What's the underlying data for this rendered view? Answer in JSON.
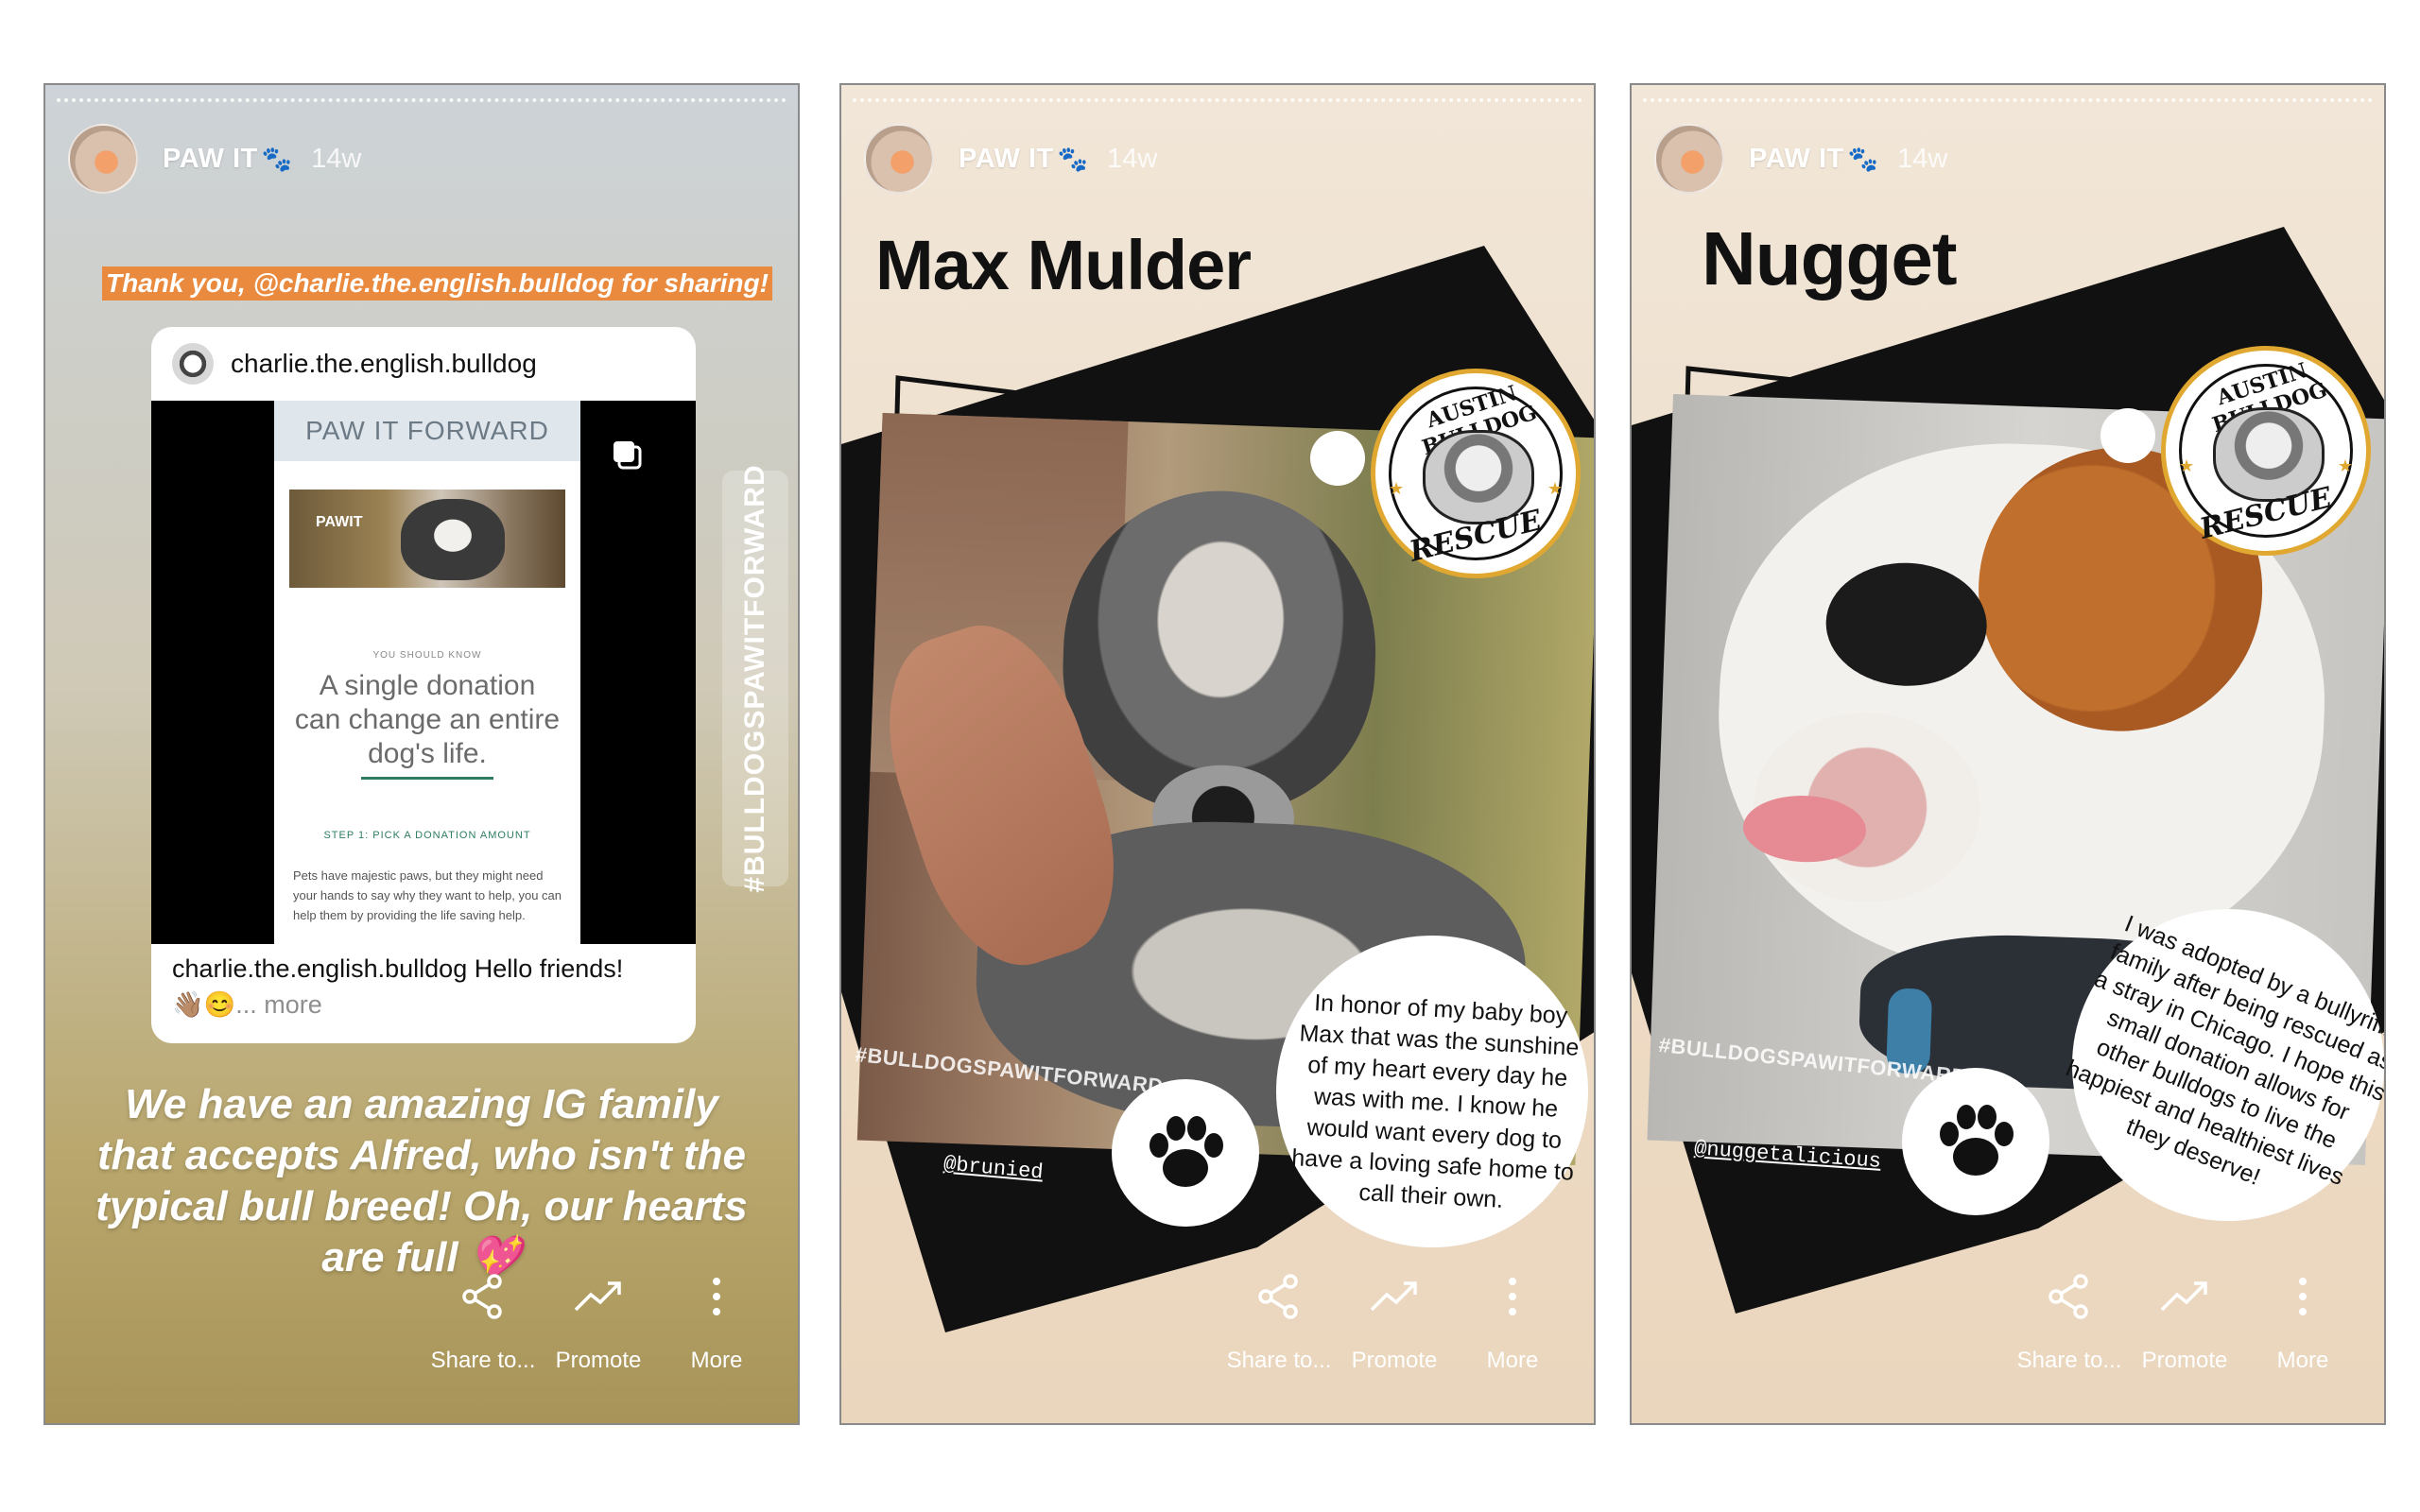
{
  "stories": [
    {
      "header": {
        "account": "PAW IT",
        "paws": "🐾",
        "age": "14w"
      },
      "mention_banner": "Thank you, @charlie.the.english.bulldog for sharing!",
      "shared_post": {
        "username": "charlie.the.english.bulldog",
        "site_title": "PAW IT FORWARD",
        "photo_label": "PAWIT",
        "kicker": "YOU SHOULD KNOW",
        "headline": "A single donation can change an entire dog's life.",
        "step": "STEP 1: PICK A DONATION AMOUNT",
        "paragraph": "Pets have majestic paws, but they might need your hands to say why they want to help, you can help them by providing the life saving help.",
        "caption_user": "charlie.the.english.bulldog",
        "caption_text": "Hello friends!",
        "caption_emoji": "👋🏽😊",
        "more": "... more"
      },
      "hashtag": "#BULLDOGSPAWITFORWARD",
      "story_text": "We have an amazing IG family that accepts Alfred, who isn't the typical bull breed! Oh, our hearts are full 💖"
    },
    {
      "header": {
        "account": "PAW IT",
        "paws": "🐾",
        "age": "14w"
      },
      "title": "Max Mulder",
      "logo_top": "AUSTIN BULLDOG",
      "logo_bottom": "RESCUE",
      "hashtag": "#BULLDOGSPAWITFORWARD",
      "handle": "@brunied",
      "bubble": "In honor of my baby boy Max that was the sunshine of my heart every day he was with me. I know he would want every dog to have a loving safe home to call their own."
    },
    {
      "header": {
        "account": "PAW IT",
        "paws": "🐾",
        "age": "14w"
      },
      "title": "Nugget",
      "logo_top": "AUSTIN BULLDOG",
      "logo_bottom": "RESCUE",
      "hashtag": "#BULLDOGSPAWITFORWARD",
      "handle": "@nuggetalicious",
      "bubble": "I was adopted by a bullyriffic family after being rescued as a stray in Chicago. I hope this small donation allows for other bulldogs to live the happiest and healthiest lives they deserve!"
    }
  ],
  "actions": {
    "share": "Share to...",
    "promote": "Promote",
    "more": "More"
  },
  "icons": [
    "share-icon",
    "promote-icon",
    "more-vertical-icon",
    "paw-print-icon",
    "copy-icon"
  ],
  "colors": {
    "banner_orange": "#e98a3e",
    "logo_gold": "#e0a830",
    "panel_black": "#111111"
  }
}
